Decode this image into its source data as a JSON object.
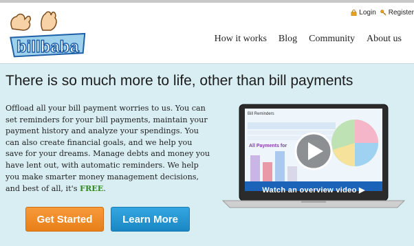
{
  "auth": {
    "login": "Login",
    "register": "Register"
  },
  "logo": {
    "text": "billbaba"
  },
  "nav": [
    {
      "label": "How it works"
    },
    {
      "label": "Blog"
    },
    {
      "label": "Community"
    },
    {
      "label": "About us"
    }
  ],
  "hero": {
    "title": "There is so much more to life, other than bill payments",
    "body": "Offload all your bill payment worries to us. You can set reminders for your bill payments, maintain your payment history and analyze your spendings. You can also create financial goals, and we help you save for your dreams. Manage debts and money you have lent out, with automatic reminders. We help you make smarter money management decisions, and best of all, it's",
    "free_word": "FREE",
    "free_suffix": "."
  },
  "buttons": {
    "get_started": "Get Started",
    "learn_more": "Learn More"
  },
  "video": {
    "screen_title": "Bill Reminders",
    "screen_subtitle": "All Payments for",
    "caption": "Watch an overview video"
  },
  "colors": {
    "background": "#d9eef3",
    "orange_button": "#f08a27",
    "blue_button": "#2397d3",
    "free_green": "#2e8b1f",
    "logo_blue": "#2a6fc0"
  }
}
